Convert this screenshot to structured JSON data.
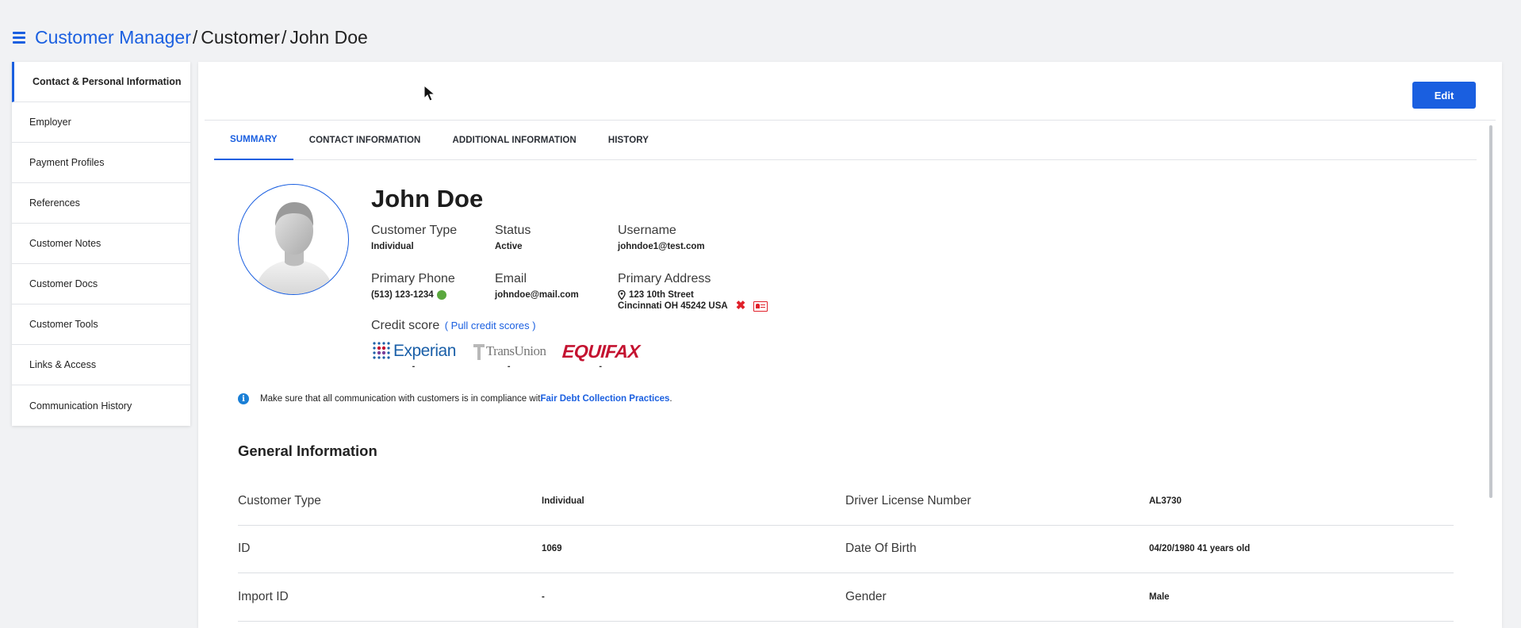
{
  "breadcrumb": {
    "root": "Customer Manager",
    "items": [
      "Customer",
      "John Doe"
    ],
    "separator": "/"
  },
  "sidebar": {
    "items": [
      {
        "label": "Contact & Personal Information",
        "active": true
      },
      {
        "label": "Employer"
      },
      {
        "label": "Payment Profiles"
      },
      {
        "label": "References"
      },
      {
        "label": "Customer Notes"
      },
      {
        "label": "Customer Docs"
      },
      {
        "label": "Customer Tools"
      },
      {
        "label": "Links & Access"
      },
      {
        "label": "Communication History"
      }
    ]
  },
  "toolbar": {
    "edit_label": "Edit"
  },
  "tabs": [
    {
      "label": "SUMMARY",
      "active": true
    },
    {
      "label": "CONTACT INFORMATION"
    },
    {
      "label": "ADDITIONAL INFORMATION"
    },
    {
      "label": "HISTORY"
    }
  ],
  "profile": {
    "name": "John Doe",
    "customer_type_label": "Customer Type",
    "customer_type": "Individual",
    "status_label": "Status",
    "status": "Active",
    "username_label": "Username",
    "username": "johndoe1@test.com",
    "phone_label": "Primary Phone",
    "phone": "(513) 123-1234",
    "email_label": "Email",
    "email": "johndoe@mail.com",
    "address_label": "Primary Address",
    "address_line1": "123 10th Street",
    "address_line2": "Cincinnati OH 45242 USA"
  },
  "credit": {
    "label": "Credit score",
    "pull_link": "( Pull credit scores )",
    "bureaus": [
      {
        "name": "Experian",
        "score": "-"
      },
      {
        "name": "TransUnion",
        "score": "-"
      },
      {
        "name": "EQUIFAX",
        "score": "-"
      }
    ]
  },
  "notice": {
    "text": "Make sure that all communication with customers is in compliance wit ",
    "link": "Fair Debt Collection Practices",
    "suffix": "."
  },
  "general": {
    "title": "General Information",
    "rows": [
      {
        "label1": "Customer Type",
        "value1": "Individual",
        "label2": "Driver License Number",
        "value2": "AL3730"
      },
      {
        "label1": "ID",
        "value1": "1069",
        "label2": "Date Of Birth",
        "value2": "04/20/1980 41 years old"
      },
      {
        "label1": "Import ID",
        "value1": "-",
        "label2": "Gender",
        "value2": "Male"
      }
    ]
  },
  "colors": {
    "accent": "#1a5fe0",
    "active_status": "#5aa83e",
    "danger": "#e0202a"
  }
}
